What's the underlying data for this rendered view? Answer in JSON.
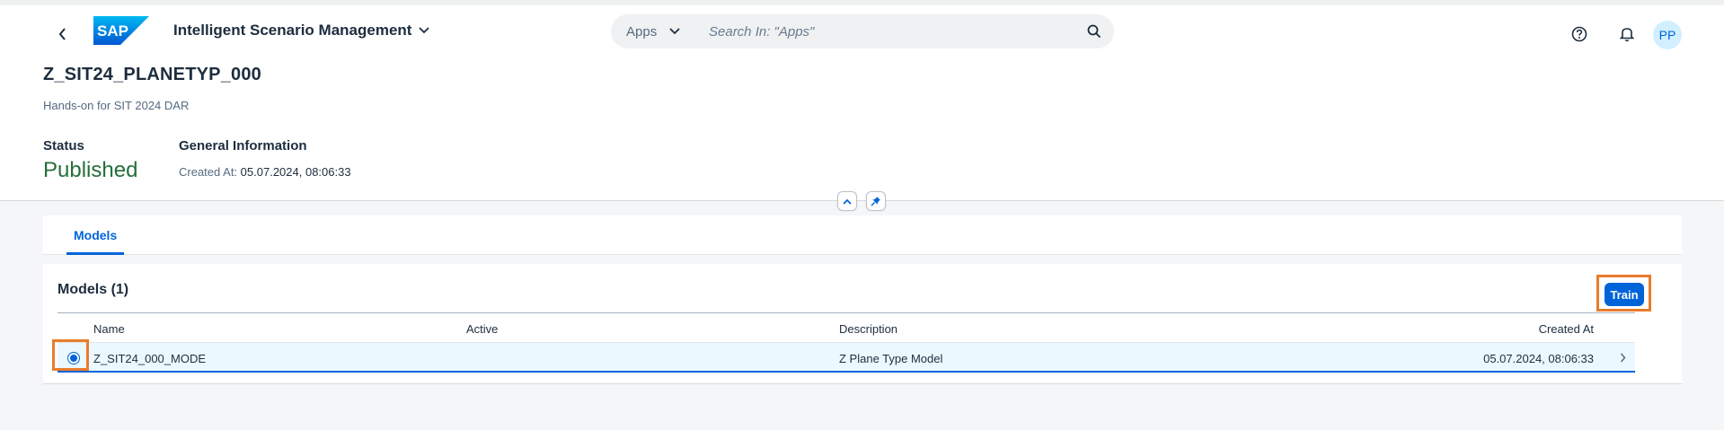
{
  "shell": {
    "app_title": "Intelligent Scenario Management",
    "search_scope": "Apps",
    "search_placeholder": "Search In: \"Apps\"",
    "avatar_initials": "PP",
    "logo_text": "SAP"
  },
  "header": {
    "title": "Z_SIT24_PLANETYP_000",
    "subtitle": "Hands-on for SIT 2024 DAR",
    "status_label": "Status",
    "status_value": "Published",
    "general_info_label": "General Information",
    "created_at_label": "Created At:",
    "created_at_value": "05.07.2024, 08:06:33"
  },
  "tabs": [
    {
      "label": "Models",
      "selected": true
    }
  ],
  "models_table": {
    "title": "Models (1)",
    "train_label": "Train",
    "columns": [
      "Name",
      "Active",
      "Description",
      "Created At"
    ],
    "rows": [
      {
        "name": "Z_SIT24_000_MODE",
        "active": "",
        "description": "Z Plane Type Model",
        "created_at": "05.07.2024, 08:06:33",
        "selected": true
      }
    ]
  },
  "colors": {
    "brand_blue": "#0064d9",
    "status_green": "#256f3a",
    "highlight_orange": "#e87c2b",
    "selected_row": "#ebf8ff"
  },
  "icons": [
    "back-icon",
    "chevron-down-icon",
    "search-icon",
    "help-icon",
    "bell-icon",
    "collapse-up-icon",
    "pin-icon",
    "row-navigation-icon"
  ]
}
